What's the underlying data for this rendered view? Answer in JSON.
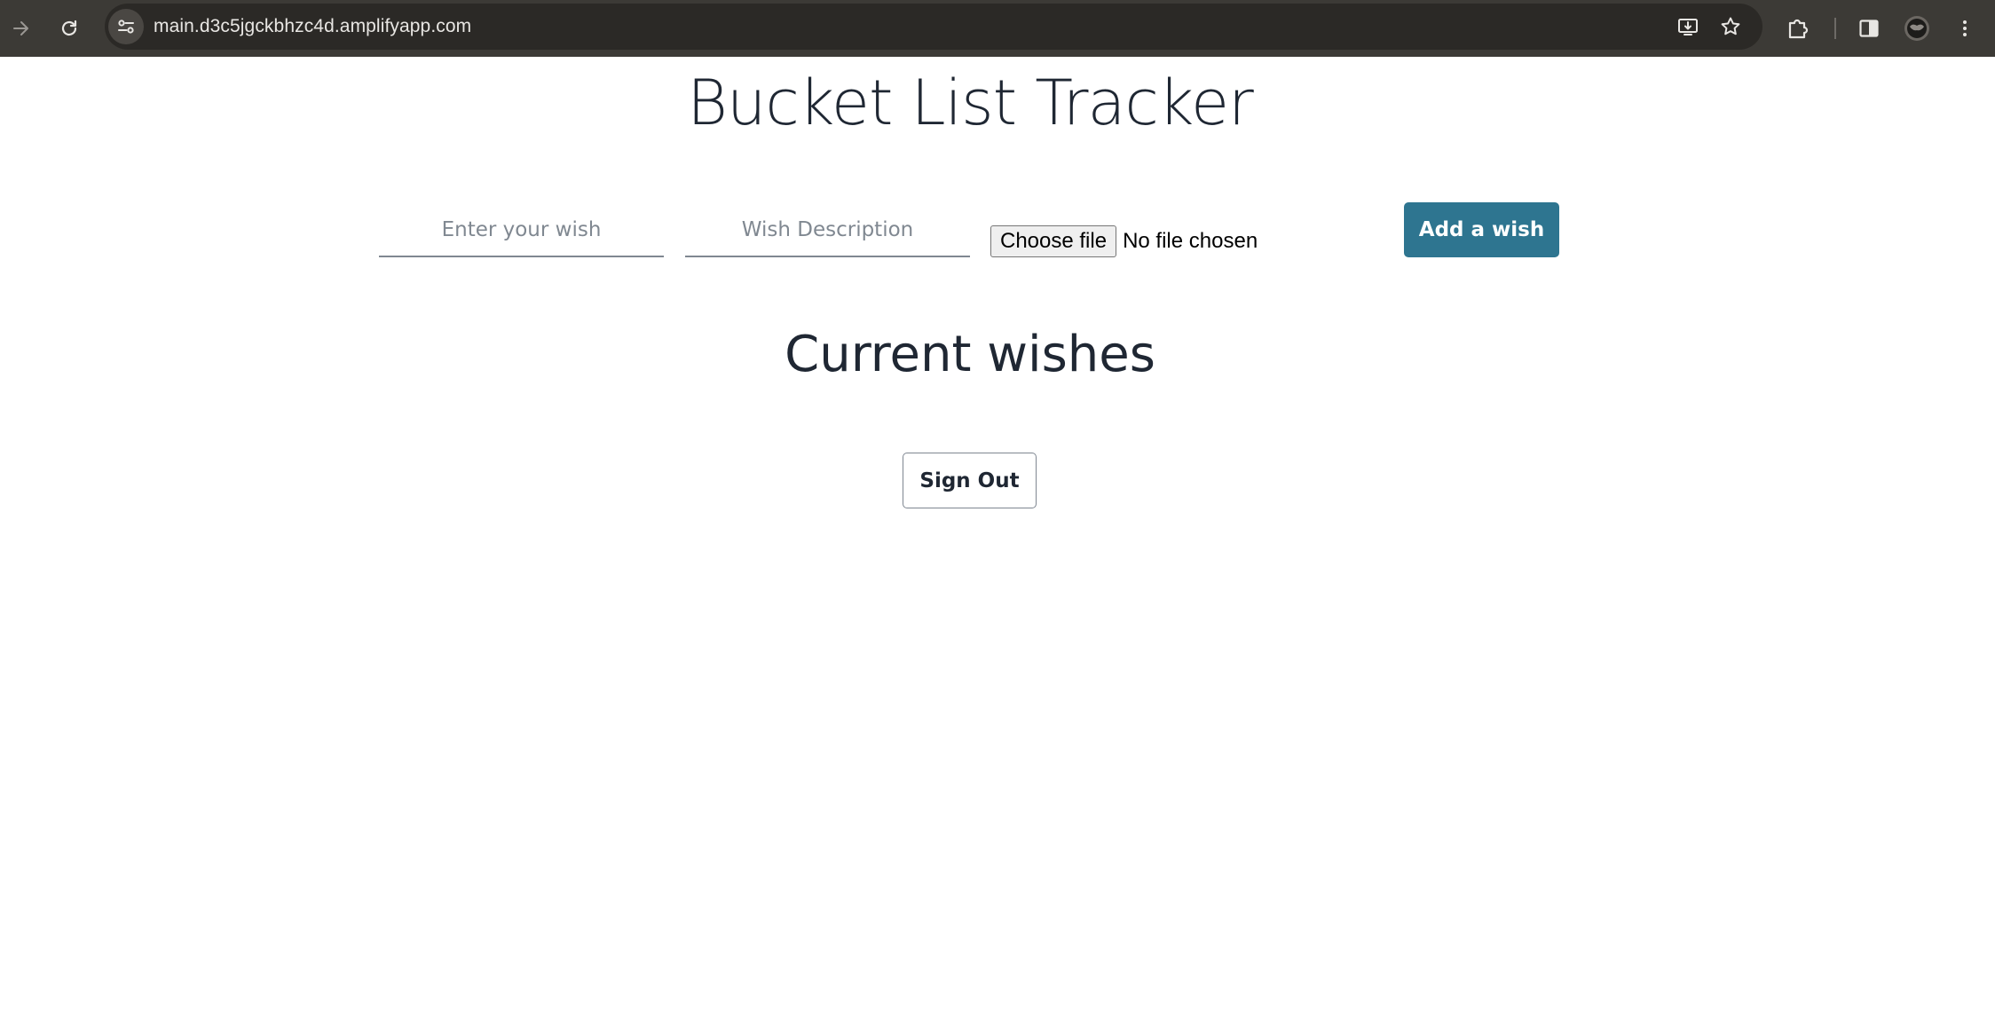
{
  "browser": {
    "url": "main.d3c5jgckbhzc4d.amplifyapp.com",
    "icons": {
      "forward": "forward-arrow-icon",
      "reload": "reload-icon",
      "site_info": "tune-icon",
      "install": "install-app-icon",
      "bookmark": "star-icon",
      "extensions": "puzzle-icon",
      "side_panel": "side-panel-icon",
      "profile": "avatar",
      "menu": "kebab-menu-icon"
    }
  },
  "page": {
    "title": "Bucket List Tracker",
    "form": {
      "wish_placeholder": "Enter your wish",
      "description_placeholder": "Wish Description",
      "choose_file_label": "Choose file",
      "file_status": "No file chosen",
      "add_button_label": "Add a wish"
    },
    "wishes_heading": "Current wishes",
    "sign_out_label": "Sign Out"
  },
  "colors": {
    "toolbar_bg": "#3c3a36",
    "omnibox_bg": "#2b2926",
    "accent": "#2e7590",
    "text_dark": "#1f2733"
  }
}
